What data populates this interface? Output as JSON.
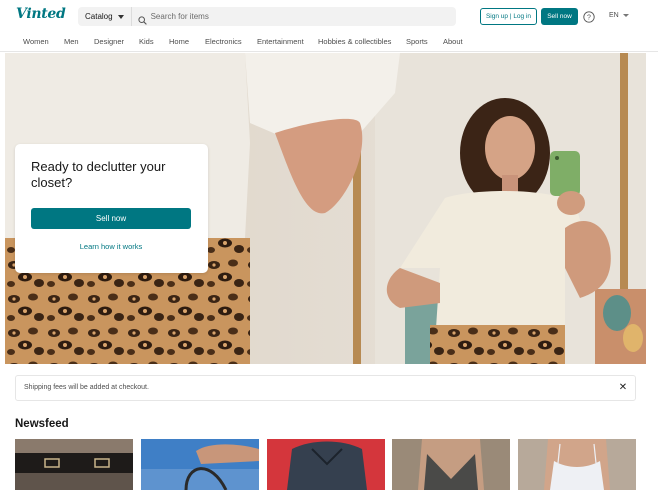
{
  "header": {
    "logo": "Vinted",
    "catalog_label": "Catalog",
    "search_placeholder": "Search for items",
    "signup_label": "Sign up | Log in",
    "sell_label": "Sell now",
    "language": "EN"
  },
  "nav": {
    "items": [
      "Women",
      "Men",
      "Designer",
      "Kids",
      "Home",
      "Electronics",
      "Entertainment",
      "Hobbies & collectibles",
      "Sports",
      "About"
    ]
  },
  "hero": {
    "title": "Ready to declutter your closet?",
    "sell_label": "Sell now",
    "learn_label": "Learn how it works"
  },
  "notice": {
    "text": "Shipping fees will be added at checkout.",
    "close": "✕"
  },
  "newsfeed": {
    "title": "Newsfeed"
  },
  "colors": {
    "brand": "#007782",
    "text": "#171717",
    "muted": "#4d4d4d"
  }
}
